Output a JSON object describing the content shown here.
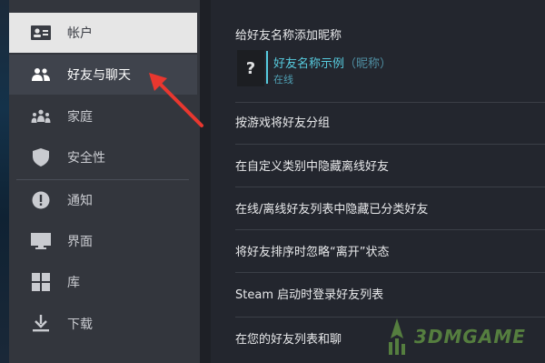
{
  "sidebar": {
    "items": [
      {
        "label": "帐户",
        "icon": "id-card-icon"
      },
      {
        "label": "好友与聊天",
        "icon": "friends-icon"
      },
      {
        "label": "家庭",
        "icon": "family-icon"
      },
      {
        "label": "安全性",
        "icon": "shield-icon"
      },
      {
        "label": "通知",
        "icon": "alert-icon"
      },
      {
        "label": "界面",
        "icon": "monitor-icon"
      },
      {
        "label": "库",
        "icon": "grid-icon"
      },
      {
        "label": "下载",
        "icon": "download-icon"
      }
    ]
  },
  "main": {
    "nickname_section": {
      "title": "给好友名称添加昵称",
      "example_name": "好友名称示例",
      "example_nickname": "（昵称）",
      "example_status": "在线",
      "avatar_placeholder": "?"
    },
    "settings": [
      "按游戏将好友分组",
      "在自定义类别中隐藏离线好友",
      "在线/离线好友列表中隐藏已分类好友",
      "将好友排序时忽略“离开”状态",
      "Steam 启动时登录好友列表",
      "在您的好友列表和聊"
    ]
  },
  "colors": {
    "sidebar_bg": "#33363d",
    "main_bg": "#23262e",
    "accent_online": "#57cbde",
    "active_item_bg": "#e6e6e6",
    "arrow_red": "#e8372f"
  }
}
